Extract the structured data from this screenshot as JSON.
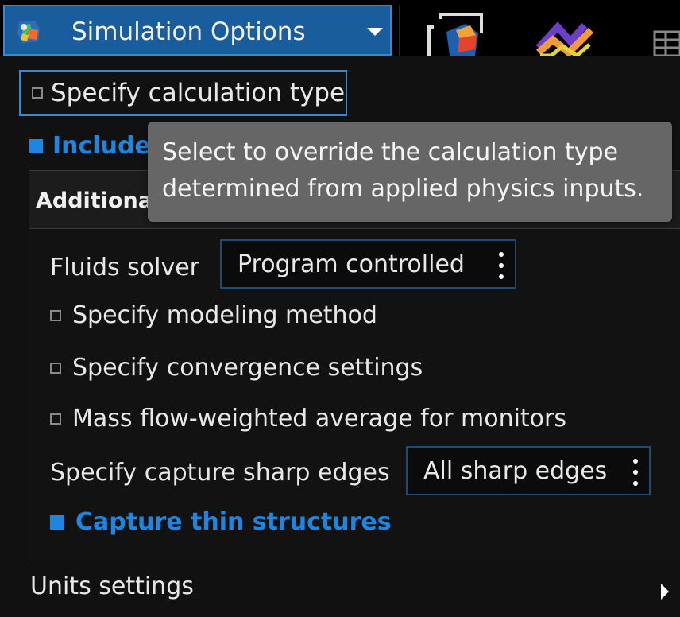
{
  "toolbar": {
    "dropdown_label": "Simulation Options",
    "app_icon": "app-logo-icon",
    "tools": [
      "geometry-icon",
      "chart-icon",
      "table-icon"
    ]
  },
  "panel": {
    "specify_calc_label": "Specify calculation type",
    "include_label_visible": "Include",
    "additional_title_visible": "Additiona",
    "fluids_solver": {
      "label": "Fluids solver",
      "value": "Program controlled"
    },
    "checks": [
      {
        "label": "Specify modeling method",
        "checked": false
      },
      {
        "label": "Specify convergence settings",
        "checked": false
      },
      {
        "label": "Mass flow-weighted average for monitors",
        "checked": false
      }
    ],
    "capture_edges": {
      "label": "Specify capture sharp edges",
      "value": "All sharp edges"
    },
    "capture_thin": {
      "label": "Capture thin structures",
      "checked": true
    },
    "units_label": "Units settings"
  },
  "tooltip": {
    "line1": "Select to override the calculation type",
    "line2": "determined from applied physics inputs."
  },
  "colors": {
    "accent": "#1e86e0",
    "dropdown_bg": "#1a5d9c",
    "tooltip_bg": "#666666"
  }
}
